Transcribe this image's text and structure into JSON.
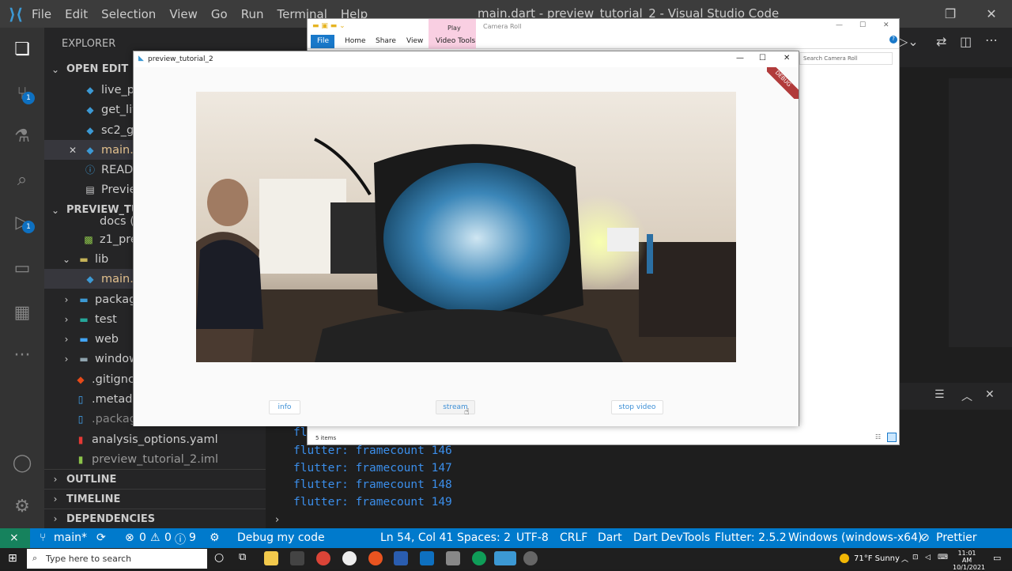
{
  "vscode": {
    "logo": "vscode-logo-icon",
    "menu": [
      "File",
      "Edit",
      "Selection",
      "View",
      "Go",
      "Run",
      "Terminal",
      "Help"
    ],
    "title": "main.dart - preview_tutorial_2 - Visual Studio Code",
    "explorer_title": "EXPLORER",
    "open_editors": "OPEN EDIT",
    "project": "PREVIEW_TUTO",
    "files": [
      {
        "label": "live_p",
        "icon": "dart-icon",
        "color": "#3c99d4"
      },
      {
        "label": "get_liv",
        "icon": "dart-icon",
        "color": "#3c99d4"
      },
      {
        "label": "sc2_ge",
        "icon": "dart-icon",
        "color": "#3c99d4"
      },
      {
        "label": "main.d",
        "icon": "dart-icon",
        "color": "#3c99d4"
      },
      {
        "label": "READM",
        "icon": "info-icon",
        "color": "#3c99d4"
      },
      {
        "label": "Previe",
        "icon": "preview-icon",
        "color": "#ccc"
      }
    ],
    "tree": [
      {
        "label": "docs (h",
        "indent": 70
      },
      {
        "label": "z1_pre",
        "indent": 92
      },
      {
        "label": "lib",
        "indent": 70
      },
      {
        "label": "main.d",
        "indent": 92
      },
      {
        "label": "packag",
        "indent": 70
      },
      {
        "label": "test",
        "indent": 70
      },
      {
        "label": "web",
        "indent": 70
      },
      {
        "label": "window",
        "indent": 70
      },
      {
        "label": ".gitignc",
        "indent": 70
      },
      {
        "label": ".metada",
        "indent": 70
      },
      {
        "label": ".packag",
        "indent": 70
      },
      {
        "label": "analysis_options.yaml",
        "indent": 70
      },
      {
        "label": "preview_tutorial_2.iml",
        "indent": 70
      }
    ],
    "sections": [
      "OUTLINE",
      "TIMELINE",
      "DEPENDENCIES"
    ],
    "badges": {
      "scm": "1",
      "debug": "1"
    },
    "terminal_lines": [
      "fl",
      "flutter: framecount 146",
      "flutter: framecount 147",
      "flutter: framecount 148",
      "flutter: framecount 149"
    ],
    "status": {
      "branch": "main*",
      "errors": "0",
      "warnings": "0",
      "infos": "9",
      "debug": "Debug my code",
      "position": "Ln 54, Col 41",
      "spaces": "Spaces: 2",
      "encoding": "UTF-8",
      "eol": "CRLF",
      "language": "Dart",
      "devtools": "Dart DevTools",
      "flutter": "Flutter: 2.5.2",
      "device": "Windows (windows-x64)",
      "prettier": "Prettier"
    }
  },
  "file_explorer": {
    "context_tab": "Play",
    "title": "Camera Roll",
    "tabs": [
      "File",
      "Home",
      "Share",
      "View",
      "Video Tools"
    ],
    "search_placeholder": "Search Camera Roll",
    "items": "5 items"
  },
  "flutter_app": {
    "title": "preview_tutorial_2",
    "debug_banner": "DEBUG",
    "buttons": [
      "info",
      "stream",
      "stop video"
    ]
  },
  "taskbar": {
    "search_placeholder": "Type here to search",
    "weather": "71°F Sunny",
    "time": "11:01 AM",
    "date": "10/1/2021"
  }
}
